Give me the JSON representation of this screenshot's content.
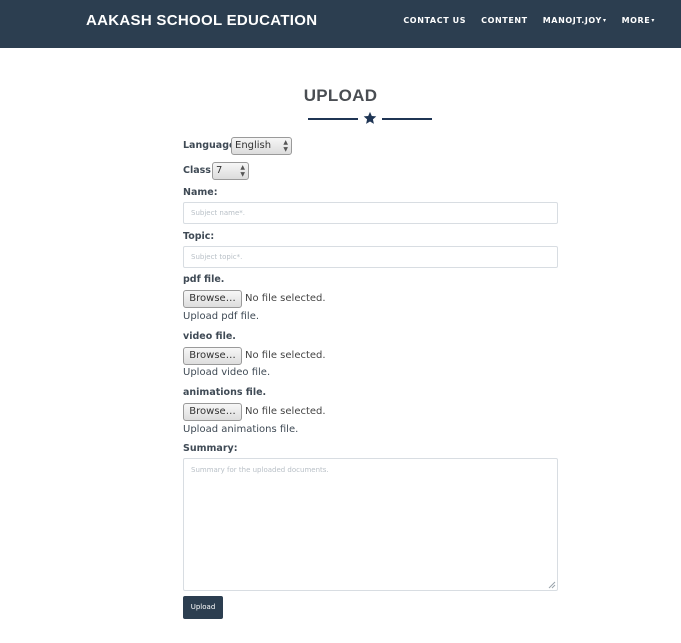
{
  "header": {
    "brand": "AAKASH SCHOOL EDUCATION",
    "nav": [
      {
        "label": "CONTACT US",
        "dropdown": false
      },
      {
        "label": "CONTENT",
        "dropdown": false
      },
      {
        "label": "MANOJT.JOY",
        "dropdown": true
      },
      {
        "label": "MORE",
        "dropdown": true
      }
    ]
  },
  "page": {
    "title": "UPLOAD",
    "divider_icon": "star-icon"
  },
  "form": {
    "language": {
      "label": "Language:",
      "value": "English"
    },
    "class": {
      "label": "Class:",
      "value": "7"
    },
    "name": {
      "label": "Name:",
      "placeholder": "Subject name*."
    },
    "topic": {
      "label": "Topic:",
      "placeholder": "Subject topic*."
    },
    "pdf": {
      "label": "pdf file.",
      "button": "Browse…",
      "status": "No file selected.",
      "help": "Upload pdf file."
    },
    "video": {
      "label": "video file.",
      "button": "Browse…",
      "status": "No file selected.",
      "help": "Upload video file."
    },
    "animations": {
      "label": "animations file.",
      "button": "Browse…",
      "status": "No file selected.",
      "help": "Upload animations file."
    },
    "summary": {
      "label": "Summary:",
      "placeholder": "Summary for the uploaded documents."
    },
    "submit_label": "Upload"
  },
  "colors": {
    "navbar": "#2c3e50",
    "accent": "#1f3554"
  }
}
